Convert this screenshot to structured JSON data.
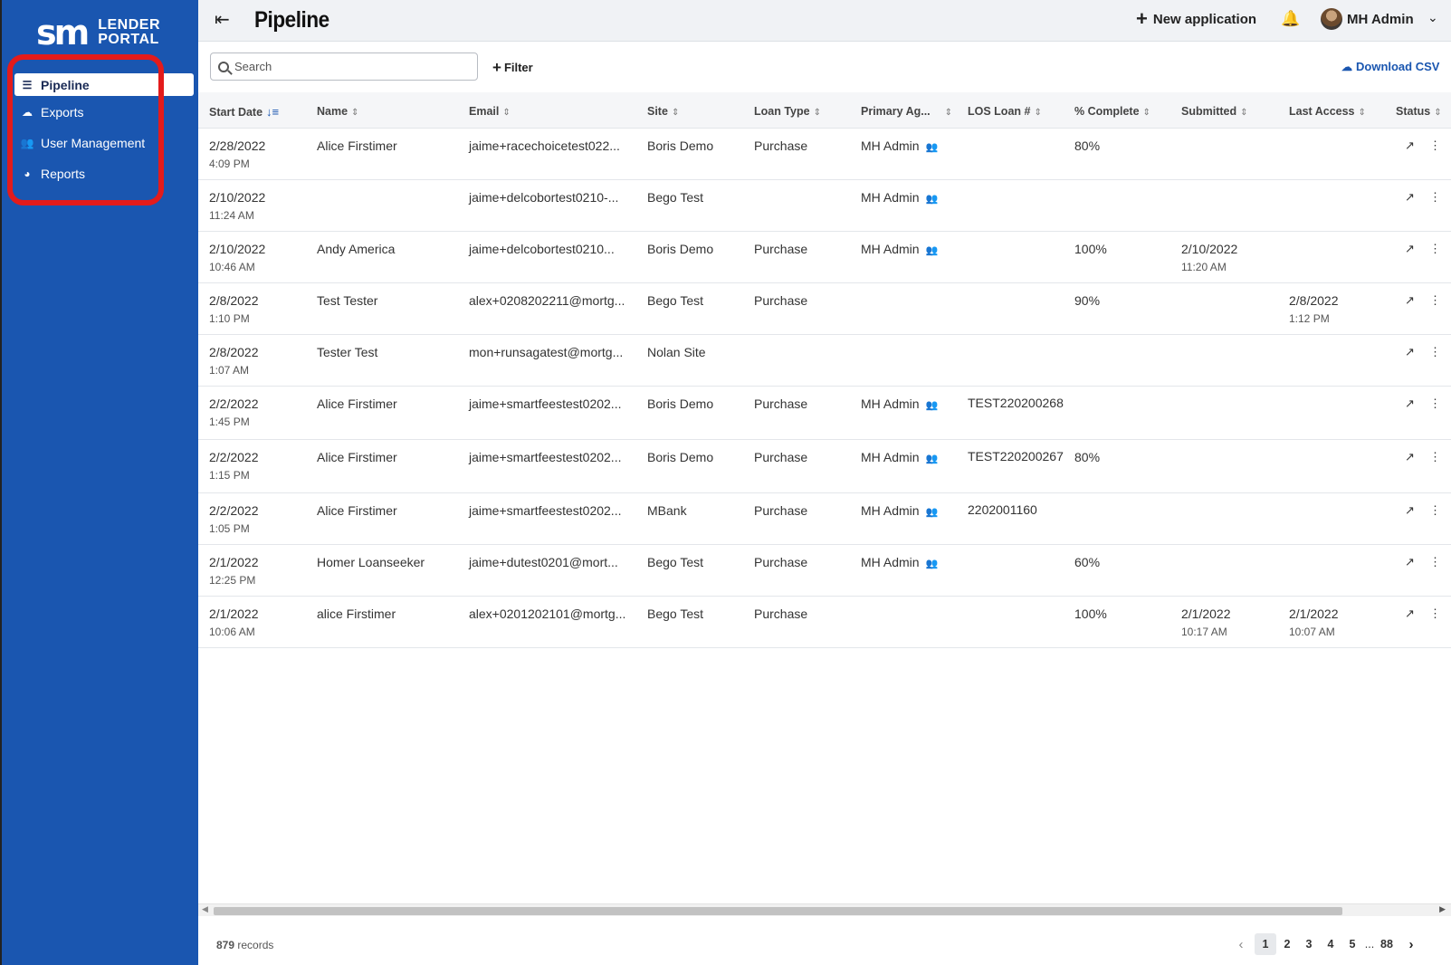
{
  "brand": {
    "mark": "sm",
    "line1": "LENDER",
    "line2": "PORTAL"
  },
  "sidebar": {
    "items": [
      {
        "label": "Pipeline",
        "icon": "list-icon",
        "glyph": "☰",
        "active": true
      },
      {
        "label": "Exports",
        "icon": "cloud-upload-icon",
        "glyph": "☁",
        "active": false
      },
      {
        "label": "User Management",
        "icon": "users-icon",
        "glyph": "👥",
        "active": false
      },
      {
        "label": "Reports",
        "icon": "pie-chart-icon",
        "glyph": "◕",
        "active": false
      }
    ]
  },
  "header": {
    "title": "Pipeline",
    "new_application": "New application",
    "user": "MH Admin"
  },
  "toolbar": {
    "search_placeholder": "Search",
    "filter": "Filter",
    "download_csv": "Download CSV"
  },
  "table": {
    "columns": [
      {
        "label": "Start Date",
        "sort": "active"
      },
      {
        "label": "Name",
        "sort": "none"
      },
      {
        "label": "Email",
        "sort": "none"
      },
      {
        "label": "Site",
        "sort": "none"
      },
      {
        "label": "Loan Type",
        "sort": "none"
      },
      {
        "label": "Primary Ag...",
        "sort": "none"
      },
      {
        "label": "LOS Loan #",
        "sort": "none"
      },
      {
        "label": "% Complete",
        "sort": "none"
      },
      {
        "label": "Submitted",
        "sort": "none"
      },
      {
        "label": "Last Access",
        "sort": "none"
      },
      {
        "label": "Status",
        "sort": "none"
      }
    ],
    "rows": [
      {
        "date": "2/28/2022",
        "time": "4:09 PM",
        "name": "Alice Firstimer",
        "email": "jaime+racechoicetest022...",
        "site": "Boris Demo",
        "loan_type": "Purchase",
        "agent": "MH Admin",
        "los": "",
        "complete": "80%",
        "submitted_date": "",
        "submitted_time": "",
        "access_date": "",
        "access_time": ""
      },
      {
        "date": "2/10/2022",
        "time": "11:24 AM",
        "name": "",
        "email": "jaime+delcobortest0210-...",
        "site": "Bego Test",
        "loan_type": "",
        "agent": "MH Admin",
        "los": "",
        "complete": "",
        "submitted_date": "",
        "submitted_time": "",
        "access_date": "",
        "access_time": ""
      },
      {
        "date": "2/10/2022",
        "time": "10:46 AM",
        "name": "Andy America",
        "email": "jaime+delcobortest0210...",
        "site": "Boris Demo",
        "loan_type": "Purchase",
        "agent": "MH Admin",
        "los": "",
        "complete": "100%",
        "submitted_date": "2/10/2022",
        "submitted_time": "11:20 AM",
        "access_date": "",
        "access_time": ""
      },
      {
        "date": "2/8/2022",
        "time": "1:10 PM",
        "name": "Test Tester",
        "email": "alex+0208202211@mortg...",
        "site": "Bego Test",
        "loan_type": "Purchase",
        "agent": "",
        "los": "",
        "complete": "90%",
        "submitted_date": "",
        "submitted_time": "",
        "access_date": "2/8/2022",
        "access_time": "1:12 PM"
      },
      {
        "date": "2/8/2022",
        "time": "1:07 AM",
        "name": "Tester Test",
        "email": "mon+runsagatest@mortg...",
        "site": "Nolan Site",
        "loan_type": "",
        "agent": "",
        "los": "",
        "complete": "",
        "submitted_date": "",
        "submitted_time": "",
        "access_date": "",
        "access_time": ""
      },
      {
        "date": "2/2/2022",
        "time": "1:45 PM",
        "name": "Alice Firstimer",
        "email": "jaime+smartfeestest0202...",
        "site": "Boris Demo",
        "loan_type": "Purchase",
        "agent": "MH Admin",
        "los": "TEST220200268",
        "complete": "",
        "submitted_date": "",
        "submitted_time": "",
        "access_date": "",
        "access_time": ""
      },
      {
        "date": "2/2/2022",
        "time": "1:15 PM",
        "name": "Alice Firstimer",
        "email": "jaime+smartfeestest0202...",
        "site": "Boris Demo",
        "loan_type": "Purchase",
        "agent": "MH Admin",
        "los": "TEST220200267",
        "complete": "80%",
        "submitted_date": "",
        "submitted_time": "",
        "access_date": "",
        "access_time": ""
      },
      {
        "date": "2/2/2022",
        "time": "1:05 PM",
        "name": "Alice Firstimer",
        "email": "jaime+smartfeestest0202...",
        "site": "MBank",
        "loan_type": "Purchase",
        "agent": "MH Admin",
        "los": "2202001160",
        "complete": "",
        "submitted_date": "",
        "submitted_time": "",
        "access_date": "",
        "access_time": ""
      },
      {
        "date": "2/1/2022",
        "time": "12:25 PM",
        "name": "Homer Loanseeker",
        "email": "jaime+dutest0201@mort...",
        "site": "Bego Test",
        "loan_type": "Purchase",
        "agent": "MH Admin",
        "los": "",
        "complete": "60%",
        "submitted_date": "",
        "submitted_time": "",
        "access_date": "",
        "access_time": ""
      },
      {
        "date": "2/1/2022",
        "time": "10:06 AM",
        "name": "alice Firstimer",
        "email": "alex+0201202101@mortg...",
        "site": "Bego Test",
        "loan_type": "Purchase",
        "agent": "",
        "los": "",
        "complete": "100%",
        "submitted_date": "2/1/2022",
        "submitted_time": "10:17 AM",
        "access_date": "2/1/2022",
        "access_time": "10:07 AM"
      }
    ]
  },
  "footer": {
    "record_count": "879",
    "record_label": "records",
    "pages": [
      "1",
      "2",
      "3",
      "4",
      "5"
    ],
    "ellipsis": "...",
    "last_page": "88",
    "current_page": "1"
  }
}
